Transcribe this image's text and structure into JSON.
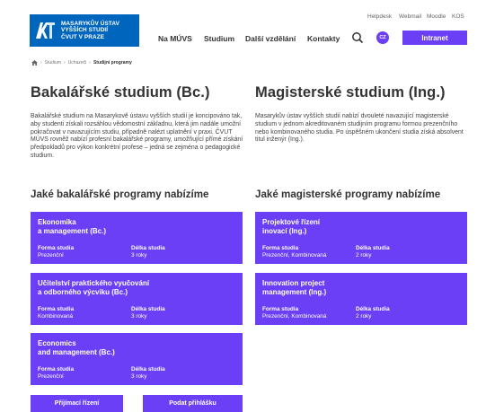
{
  "header": {
    "logo_lines": [
      "MASARYKŮV ÚSTAV",
      "VYŠŠÍCH STUDIÍ",
      "ČVUT V PRAZE"
    ],
    "util_links": [
      "Helpdesk",
      "Webmail",
      "Moodle",
      "KOS"
    ],
    "nav": [
      "Na MÚVS",
      "Studium",
      "Další vzdělání",
      "Kontakty"
    ],
    "lang": "CZ",
    "intranet": "Intranet"
  },
  "breadcrumb": [
    "Studium",
    "Uchazeči",
    "Studijní programy"
  ],
  "bachelor": {
    "title": "Bakalářské studium (Bc.)",
    "text": "Bakalářské studium na Masarykově ústavu vyšších studií je koncipováno tak, aby studenti získali rozsáhlou vědomostní základnu, která jim nadále umožní pokračovat v navazujícím studiu, případně nalézt uplatnění v praxi. ČVUT MÚVS rovněž nabízí profesní bakalářské programy, umožňující přímé získání předpokladů pro výkon konkrétní profese – jedná se zejména o pedagogické studium.",
    "programs_heading": "Jaké bakalářské programy nabízíme",
    "programs": [
      {
        "title_line1": "Ekonomika",
        "title_line2": "a management (Bc.)",
        "form_label": "Forma studia",
        "form": "Prezenční",
        "length_label": "Délka studia",
        "length": "3 roky"
      },
      {
        "title_line1": "Učitelství praktického vyučování",
        "title_line2": "a odborného výcviku (Bc.)",
        "form_label": "Forma studia",
        "form": "Kombinovaná",
        "length_label": "Délka studia",
        "length": "3 roky"
      },
      {
        "title_line1": "Economics",
        "title_line2": "and management (Bc.)",
        "form_label": "Forma studia",
        "form": "Prezenční",
        "length_label": "Délka studia",
        "length": "3 roky"
      }
    ]
  },
  "master": {
    "title": "Magisterské studium (Ing.)",
    "text": "Masarykův ústav vyšších studií nabízí dvouleté navazující magisterské studium v jednom akreditovaném studijním programu formou prezenčního nebo kombinovaného studia. Po úspěšném ukončení studia získá absolvent titul inženýr (Ing.).",
    "programs_heading": "Jaké magisterské programy nabízíme",
    "programs": [
      {
        "title_line1": "Projektové řízení",
        "title_line2": "inovací (Ing.)",
        "form_label": "Forma studia",
        "form": "Prezenční, Kombinovaná",
        "length_label": "Délka studia",
        "length": "2 roky"
      },
      {
        "title_line1": "Innovation project",
        "title_line2": "management (Ing.)",
        "form_label": "Forma studia",
        "form": "Prezenční, Kombinovaná",
        "length_label": "Délka studia",
        "length": "2 roky"
      }
    ]
  },
  "buttons": {
    "admission": "Přijímací řízení",
    "apply": "Podat přihlášku"
  },
  "colors": {
    "accent": "#6b3ff5",
    "logo_bg": "#0065bd"
  }
}
